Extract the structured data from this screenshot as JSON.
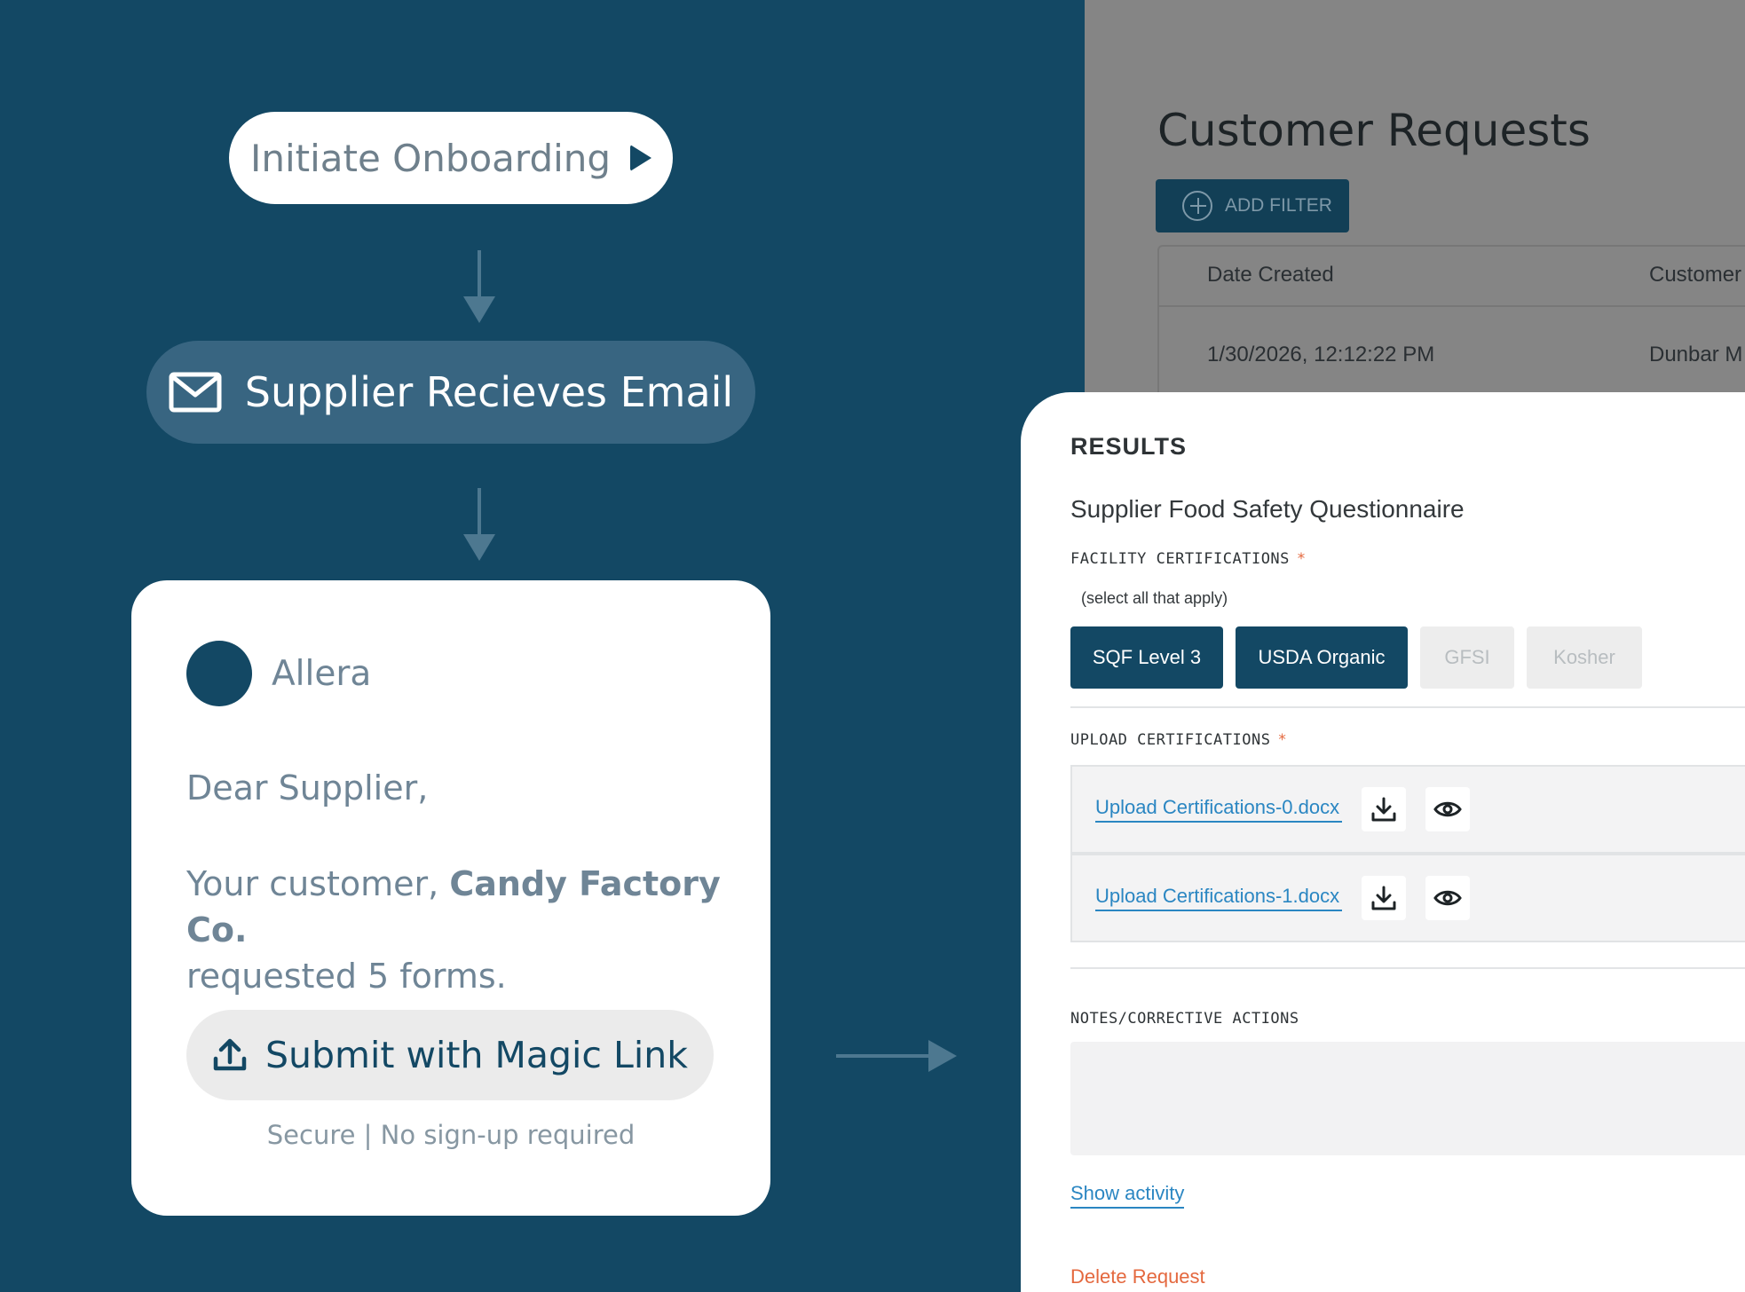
{
  "flow": {
    "initiate_label": "Initiate Onboarding",
    "email_step_label": "Supplier Recieves Email"
  },
  "email_card": {
    "sender": "Allera",
    "greeting": "Dear Supplier,",
    "body_prefix": "Your customer, ",
    "customer_name": "Candy Factory Co.",
    "body_suffix": "requested 5 forms.",
    "magic_link_label": "Submit with Magic Link",
    "secure_note": "Secure | No sign-up required"
  },
  "customer_requests": {
    "title": "Customer Requests",
    "add_filter_label": "ADD FILTER",
    "columns": [
      "Date Created",
      "Customer"
    ],
    "rows": [
      [
        "1/30/2026, 12:12:22 PM",
        "Dunbar M"
      ]
    ]
  },
  "results": {
    "title": "RESULTS",
    "questionnaire_title": "Supplier Food Safety Questionnaire",
    "facility_label": "FACILITY CERTIFICATIONS",
    "required_mark": "*",
    "select_hint": "(select all that apply)",
    "certifications": [
      {
        "label": "SQF Level 3",
        "selected": true
      },
      {
        "label": "USDA Organic",
        "selected": true
      },
      {
        "label": "GFSI",
        "selected": false
      },
      {
        "label": "Kosher",
        "selected": false
      }
    ],
    "upload_label": "UPLOAD CERTIFICATIONS",
    "files": [
      "Upload Certifications-0.docx",
      "Upload Certifications-1.docx"
    ],
    "notes_label": "NOTES/CORRECTIVE ACTIONS",
    "show_activity_label": "Show activity",
    "delete_label": "Delete Request"
  },
  "colors": {
    "background": "#134864",
    "pill_dark": "#386581",
    "accent_link": "#2a86c2",
    "danger": "#e4683e"
  }
}
